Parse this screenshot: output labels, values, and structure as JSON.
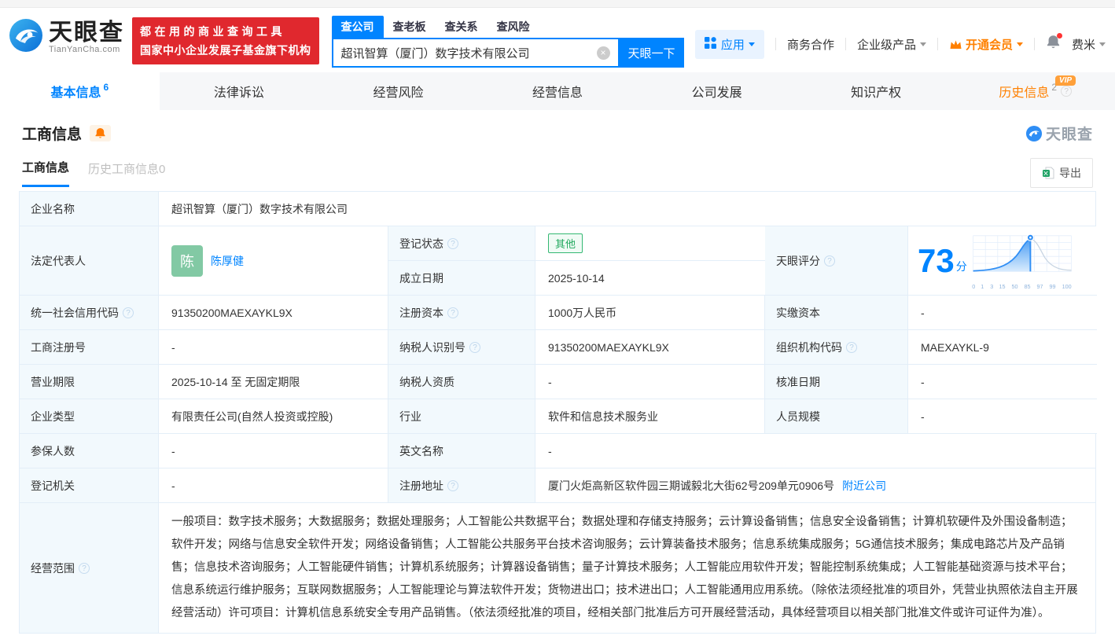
{
  "colors": {
    "brand_blue": "#0084ff",
    "accent_orange": "#ff8000",
    "slogan_red": "#e0282e",
    "avatar_green": "#82c9a4",
    "status_green": "#21a95e"
  },
  "header": {
    "logo": {
      "name": "天眼查",
      "domain": "TianYanCha.com"
    },
    "slogan": {
      "line1": "都在用的商业查询工具",
      "line2": "国家中小企业发展子基金旗下机构"
    },
    "search": {
      "tabs": [
        {
          "label": "查公司"
        },
        {
          "label": "查老板"
        },
        {
          "label": "查关系"
        },
        {
          "label": "查风险"
        }
      ],
      "value": "超讯智算（厦门）数字技术有限公司",
      "button": "天眼一下"
    },
    "nav": {
      "app": "应用",
      "cooperation": "商务合作",
      "enterprise_products": "企业级产品",
      "vip": "开通会员",
      "username": "费米"
    }
  },
  "tabs": {
    "basic": {
      "label": "基本信息",
      "count": "6"
    },
    "legal": {
      "label": "法律诉讼"
    },
    "risk": {
      "label": "经营风险"
    },
    "operation": {
      "label": "经营信息"
    },
    "development": {
      "label": "公司发展"
    },
    "ip": {
      "label": "知识产权"
    },
    "history": {
      "label": "历史信息",
      "count": "2",
      "badge": "VIP"
    }
  },
  "section": {
    "title": "工商信息",
    "watermark": "天眼查",
    "subtab_current": "工商信息",
    "subtab_history": "历史工商信息0",
    "export": "导出"
  },
  "table": {
    "company_name": {
      "label": "企业名称",
      "value": "超讯智算（厦门）数字技术有限公司"
    },
    "legal_rep": {
      "label": "法定代表人",
      "avatar_text": "陈",
      "name": "陈厚健"
    },
    "reg_status": {
      "label": "登记状态",
      "value": "其他"
    },
    "establish_date": {
      "label": "成立日期",
      "value": "2025-10-14"
    },
    "score": {
      "label": "天眼评分",
      "value": "73",
      "unit": "分",
      "axis_ticks": [
        "0",
        "1",
        "3",
        "15",
        "50",
        "85",
        "97",
        "99",
        "100"
      ]
    },
    "rows": [
      [
        {
          "label": "统一社会信用代码",
          "value": "91350200MAEXAYKL9X"
        },
        {
          "label": "注册资本",
          "value": "1000万人民币"
        },
        {
          "label": "实缴资本",
          "value": "-"
        }
      ],
      [
        {
          "label": "工商注册号",
          "value": "-"
        },
        {
          "label": "纳税人识别号",
          "value": "91350200MAEXAYKL9X"
        },
        {
          "label": "组织机构代码",
          "value": "MAEXAYKL-9"
        }
      ],
      [
        {
          "label": "营业期限",
          "value": "2025-10-14 至 无固定期限"
        },
        {
          "label": "纳税人资质",
          "value": "-"
        },
        {
          "label": "核准日期",
          "value": "-"
        }
      ],
      [
        {
          "label": "企业类型",
          "value": "有限责任公司(自然人投资或控股)"
        },
        {
          "label": "行业",
          "value": "软件和信息技术服务业"
        },
        {
          "label": "人员规模",
          "value": "-"
        }
      ]
    ],
    "insured_row": {
      "label1": "参保人数",
      "value1": "-",
      "label2": "英文名称",
      "value2": "-"
    },
    "registry_row": {
      "label1": "登记机关",
      "value1": "-",
      "label2": "注册地址",
      "value2": "厦门火炬高新区软件园三期诚毅北大街62号209单元0906号",
      "link": "附近公司"
    },
    "scope": {
      "label": "经营范围",
      "value": "一般项目：数字技术服务；大数据服务；数据处理服务；人工智能公共数据平台；数据处理和存储支持服务；云计算设备销售；信息安全设备销售；计算机软硬件及外围设备制造；软件开发；网络与信息安全软件开发；网络设备销售；人工智能公共服务平台技术咨询服务；云计算装备技术服务；信息系统集成服务；5G通信技术服务；集成电路芯片及产品销售；信息技术咨询服务；人工智能硬件销售；计算机系统服务；计算器设备销售；量子计算技术服务；人工智能应用软件开发；智能控制系统集成；人工智能基础资源与技术平台；信息系统运行维护服务；互联网数据服务；人工智能理论与算法软件开发；货物进出口；技术进出口；人工智能通用应用系统。（除依法须经批准的项目外，凭营业执照依法自主开展经营活动）许可项目：计算机信息系统安全专用产品销售。（依法须经批准的项目，经相关部门批准后方可开展经营活动，具体经营项目以相关部门批准文件或许可证件为准）。"
    }
  }
}
